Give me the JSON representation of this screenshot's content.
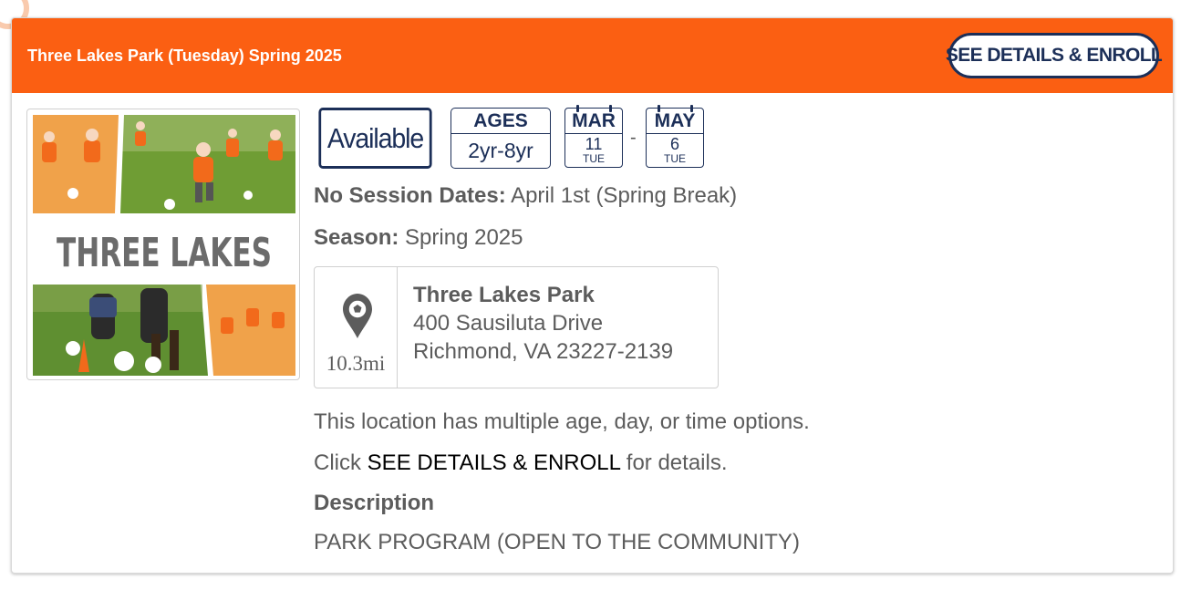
{
  "header": {
    "title": "Three Lakes Park (Tuesday) Spring 2025",
    "enroll_label": "SEE DETAILS & ENROLL",
    "accent_color": "#fb5f12",
    "brand_navy": "#1c2f58"
  },
  "image": {
    "banner_text": "THREE LAKES"
  },
  "status": {
    "label": "Available"
  },
  "ages": {
    "label": "AGES",
    "value": "2yr-8yr"
  },
  "dates": {
    "start": {
      "month": "MAR",
      "day": "11",
      "weekday": "TUE"
    },
    "separator": "-",
    "end": {
      "month": "MAY",
      "day": "6",
      "weekday": "TUE"
    }
  },
  "details": {
    "no_session_label": "No Session Dates:",
    "no_session_value": "April 1st (Spring Break)",
    "season_label": "Season:",
    "season_value": "Spring 2025"
  },
  "location": {
    "icon": "soccer-map-pin-icon",
    "distance": "10.3mi",
    "name": "Three Lakes Park",
    "street": "400 Sausiluta Drive",
    "city_line": "Richmond, VA 23227-2139"
  },
  "notes": {
    "multi_options": "This location has multiple age, day, or time options.",
    "click_prefix": "Click",
    "click_link": "SEE DETAILS & ENROLL",
    "click_suffix": "for details."
  },
  "description": {
    "heading": "Description",
    "text": "PARK PROGRAM (OPEN TO THE COMMUNITY)"
  }
}
